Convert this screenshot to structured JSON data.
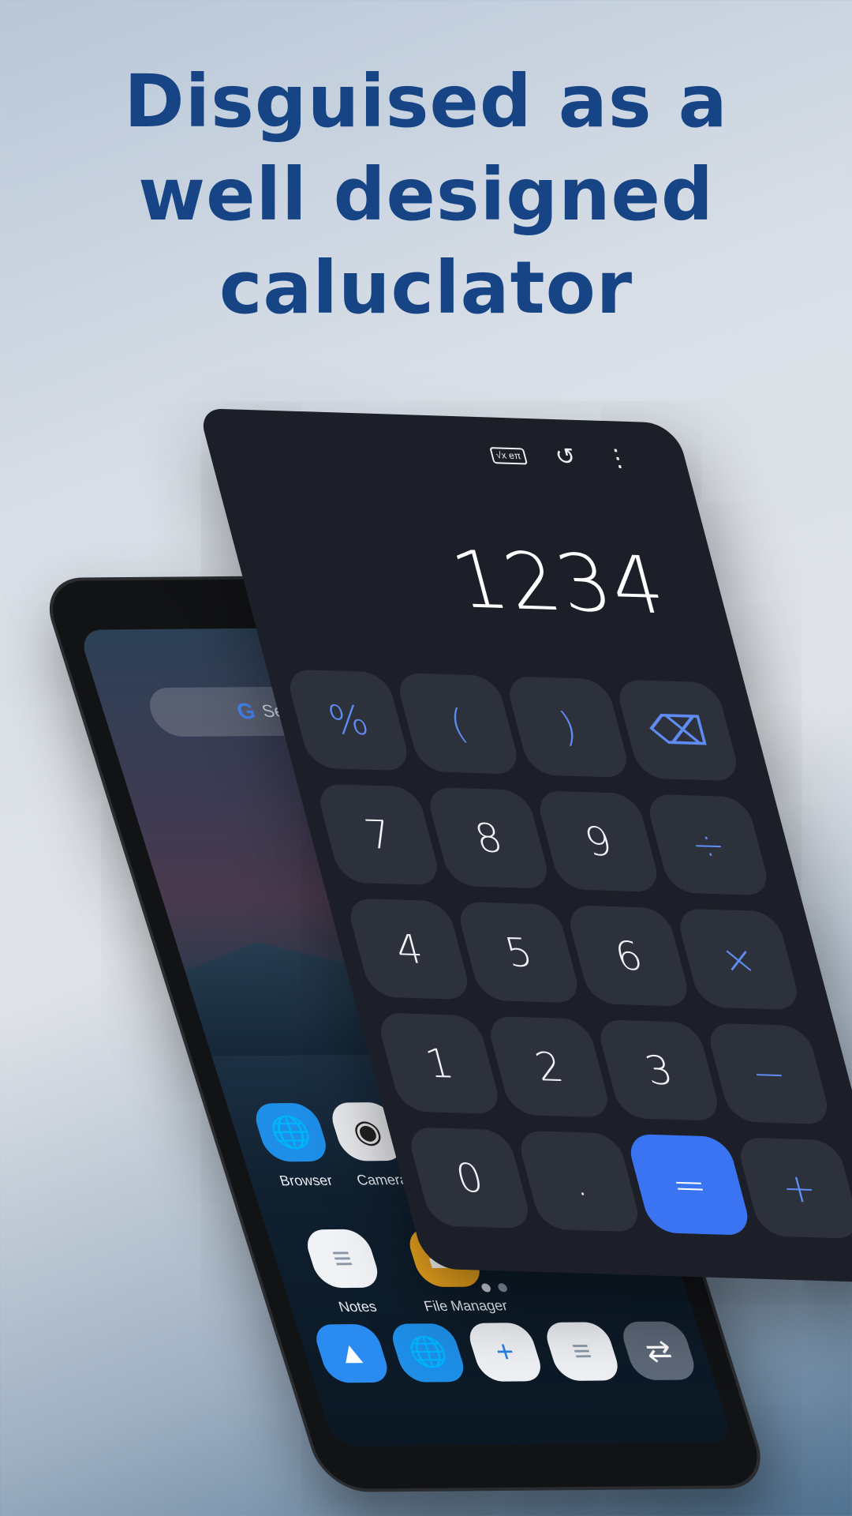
{
  "headline": {
    "lines": [
      "Disguised as a",
      "well designed",
      "caluclator"
    ]
  },
  "phone": {
    "search_placeholder": "Search",
    "apps": [
      {
        "label": "Browser",
        "icon": "globe-icon"
      },
      {
        "label": "Camera",
        "icon": "camera-icon"
      },
      {
        "label": "Notes",
        "icon": "notes-icon"
      },
      {
        "label": "File Manager",
        "icon": "folder-icon"
      }
    ],
    "dock": [
      "gallery-icon",
      "browser-icon",
      "add-icon",
      "notes-icon",
      "settings-toggle-icon"
    ]
  },
  "calculator": {
    "display": "1234",
    "top_icons": {
      "scientific": "√x eπ",
      "history": "history-icon",
      "menu": "more-vert-icon"
    },
    "keys": [
      {
        "label": "%",
        "type": "fn"
      },
      {
        "label": "(",
        "type": "fn"
      },
      {
        "label": ")",
        "type": "fn"
      },
      {
        "label": "⌫",
        "type": "fn"
      },
      {
        "label": "7",
        "type": "num"
      },
      {
        "label": "8",
        "type": "num"
      },
      {
        "label": "9",
        "type": "num"
      },
      {
        "label": "÷",
        "type": "fn"
      },
      {
        "label": "4",
        "type": "num"
      },
      {
        "label": "5",
        "type": "num"
      },
      {
        "label": "6",
        "type": "num"
      },
      {
        "label": "×",
        "type": "fn"
      },
      {
        "label": "1",
        "type": "num"
      },
      {
        "label": "2",
        "type": "num"
      },
      {
        "label": "3",
        "type": "num"
      },
      {
        "label": "−",
        "type": "fn"
      },
      {
        "label": "0",
        "type": "num"
      },
      {
        "label": ".",
        "type": "num"
      },
      {
        "label": "=",
        "type": "eq"
      },
      {
        "label": "+",
        "type": "fn"
      }
    ],
    "colors": {
      "panel": "#1c1f27",
      "key": "#2d313c",
      "accent": "#3a74f2"
    }
  }
}
